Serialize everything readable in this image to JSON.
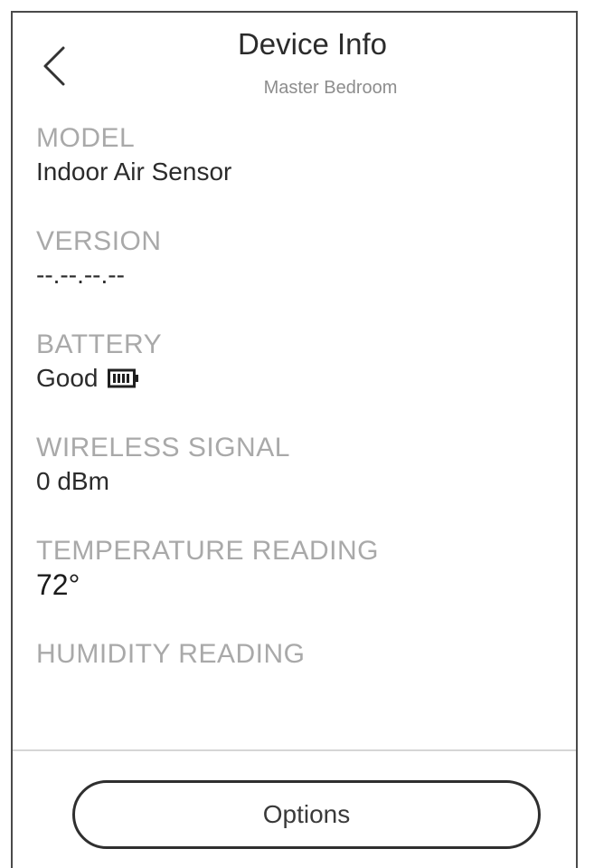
{
  "header": {
    "title": "Device Info",
    "subtitle": "Master Bedroom",
    "back_icon": "chevron-left-icon"
  },
  "fields": [
    {
      "label": "MODEL",
      "value": "Indoor Air Sensor"
    },
    {
      "label": "VERSION",
      "value": "--.--.--.--"
    },
    {
      "label": "BATTERY",
      "value": "Good",
      "icon": "battery-full-icon"
    },
    {
      "label": "WIRELESS SIGNAL",
      "value": "0 dBm"
    },
    {
      "label": "TEMPERATURE READING",
      "value": "72°"
    },
    {
      "label": "HUMIDITY READING",
      "value": ""
    }
  ],
  "footer": {
    "options_label": "Options"
  },
  "colors": {
    "label": "#a9a9a9",
    "value": "#2b2b2b",
    "border": "#2f2f2f"
  }
}
